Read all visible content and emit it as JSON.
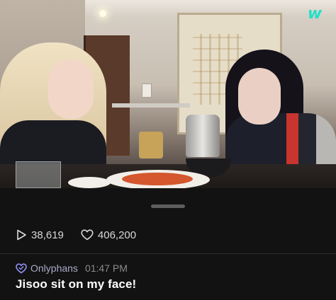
{
  "app": {
    "logo_text": "w",
    "accent_color": "#22e0c8"
  },
  "video": {
    "description_icon": "video-frame"
  },
  "stats": {
    "plays": "38,619",
    "likes": "406,200",
    "plays_icon": "play-icon",
    "likes_icon": "heart-icon"
  },
  "post": {
    "author": "Onlyphans",
    "time": "01:47 PM",
    "verified_icon": "verified-heart-icon",
    "text": "Jisoo sit on my face!"
  }
}
